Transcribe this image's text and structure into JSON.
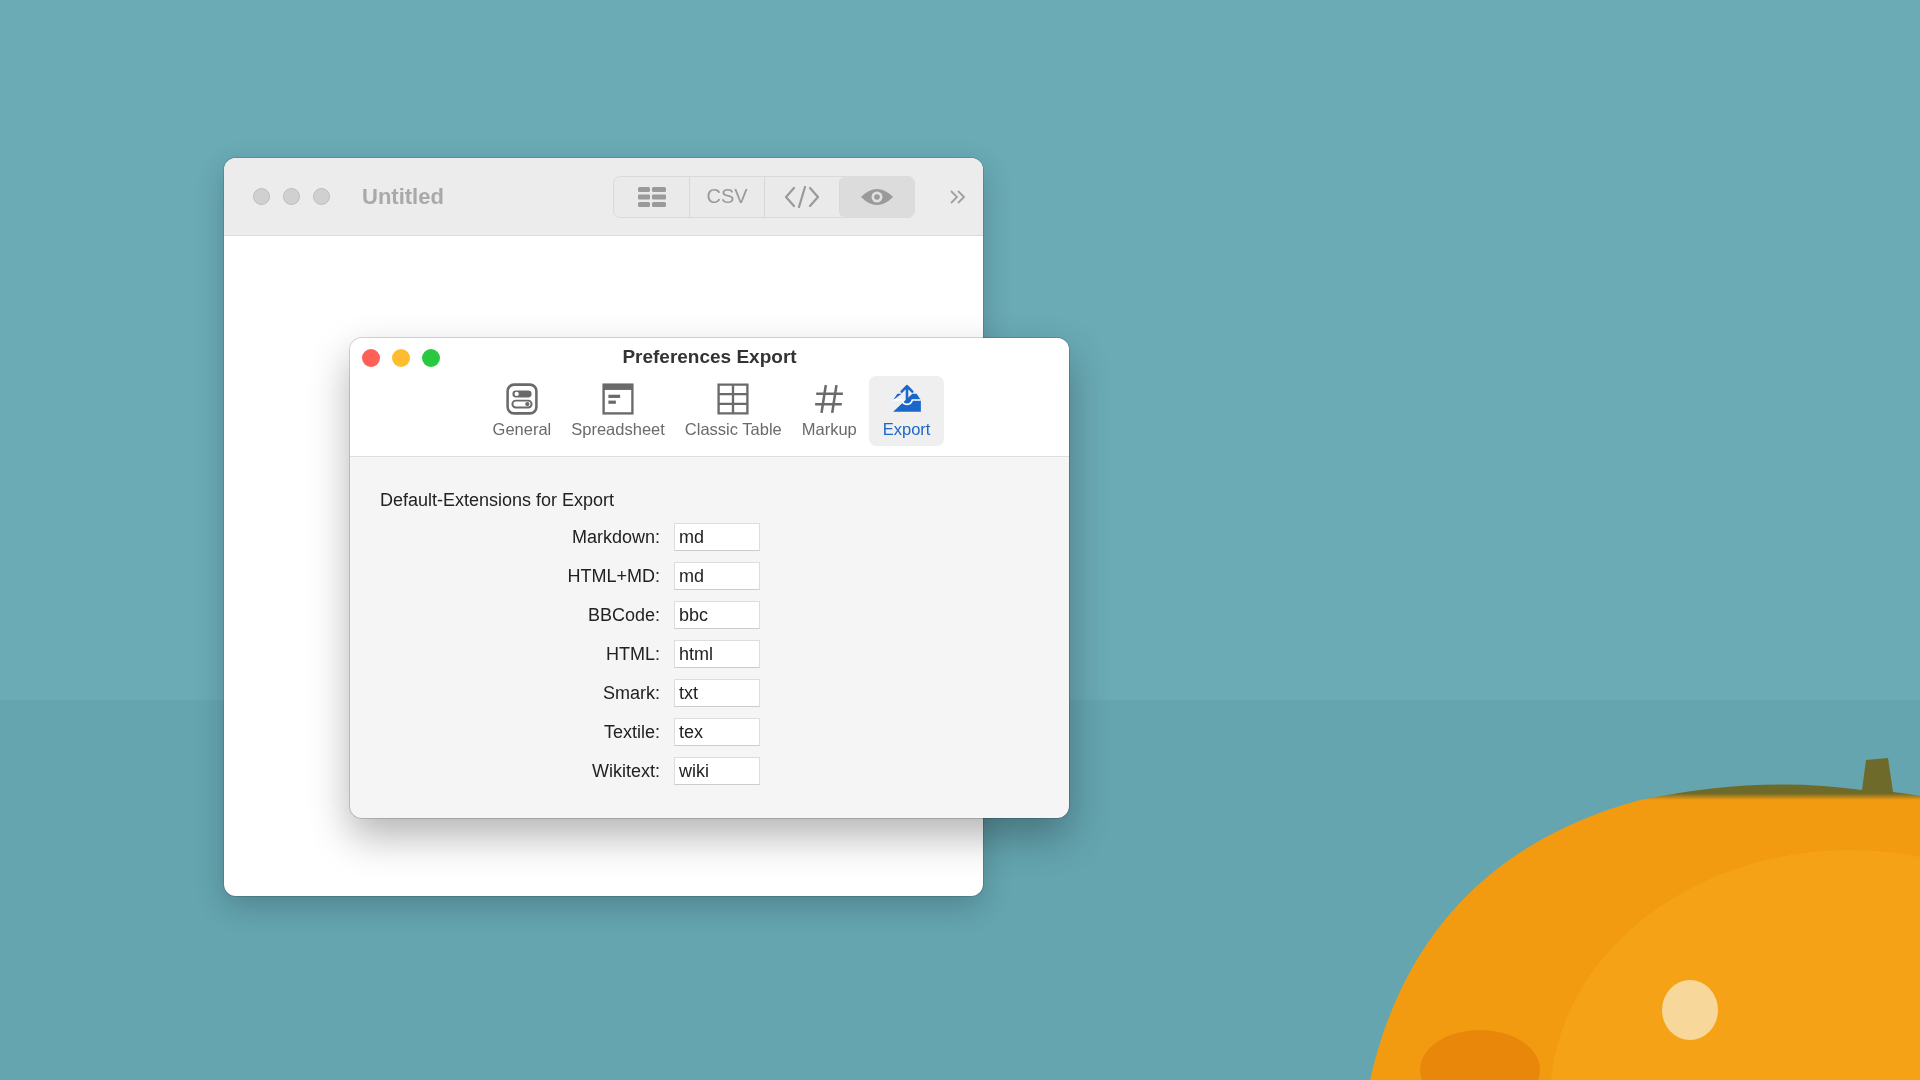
{
  "back_window": {
    "title": "Untitled",
    "segments": [
      {
        "kind": "grid",
        "selected": false
      },
      {
        "kind": "text",
        "label": "CSV",
        "selected": false
      },
      {
        "kind": "code",
        "selected": false
      },
      {
        "kind": "eye",
        "selected": true
      }
    ]
  },
  "preferences_window": {
    "title": "Preferences Export",
    "tabs": [
      {
        "kind": "general",
        "label": "General",
        "selected": false
      },
      {
        "kind": "spreadsheet",
        "label": "Spreadsheet",
        "selected": false
      },
      {
        "kind": "table",
        "label": "Classic Table",
        "selected": false
      },
      {
        "kind": "markup",
        "label": "Markup",
        "selected": false
      },
      {
        "kind": "export",
        "label": "Export",
        "selected": true
      }
    ],
    "section_title": "Default-Extensions for Export",
    "fields": [
      {
        "label": "Markdown:",
        "value": "md"
      },
      {
        "label": "HTML+MD:",
        "value": "md"
      },
      {
        "label": "BBCode:",
        "value": "bbc"
      },
      {
        "label": "HTML:",
        "value": "html"
      },
      {
        "label": "Smark:",
        "value": "txt"
      },
      {
        "label": "Textile:",
        "value": "tex"
      },
      {
        "label": "Wikitext:",
        "value": "wiki"
      }
    ]
  }
}
